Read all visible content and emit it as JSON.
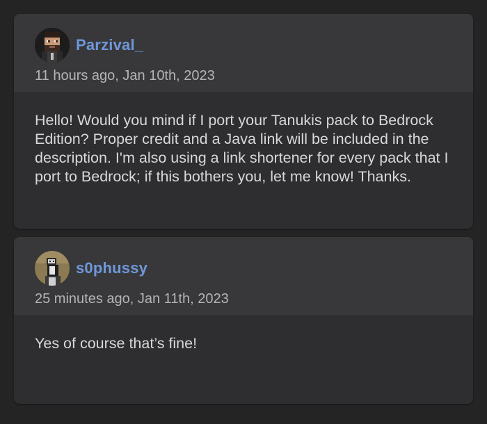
{
  "comments": [
    {
      "author": "Parzival_",
      "avatar_icon": "pixel-character-avatar-icon",
      "time": "11 hours ago, Jan 10th, 2023",
      "text": "Hello! Would you mind if I port your Tanukis pack to Bedrock Edition? Proper credit and a Java link will be included in the description. I'm also using a link shortener for every pack that I port to Bedrock; if this bothers you, let me know! Thanks."
    },
    {
      "author": "s0phussy",
      "avatar_icon": "pixel-character-avatar-icon",
      "time": "25 minutes ago, Jan 11th, 2023",
      "text": "Yes of course that’s fine!"
    }
  ],
  "colors": {
    "background": "#242424",
    "card": "#2e2e30",
    "card_header": "#38383a",
    "username": "#6f97d9",
    "timestamp": "#b4b4b8",
    "body_text": "#d8d8da"
  }
}
